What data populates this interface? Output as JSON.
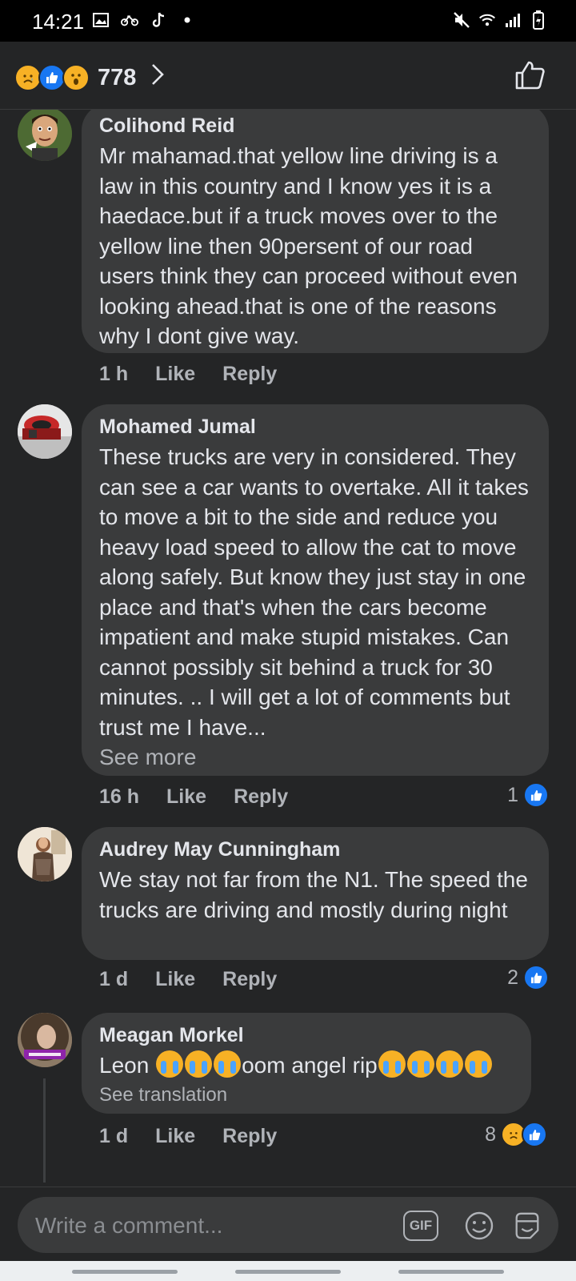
{
  "status": {
    "time": "14:21"
  },
  "header": {
    "reaction_count": "778"
  },
  "comments": [
    {
      "author": "Colihond Reid",
      "text": "Mr mahamad.that yellow line driving is a law in this country and I know yes it is a haedace.but if a truck moves over to the yellow line then 90persent of our road users think they can proceed without even looking ahead.that is one of the reasons why I dont give way.",
      "time": "1 h",
      "like": "Like",
      "reply": "Reply"
    },
    {
      "author": "Mohamed Jumal",
      "text": "These trucks are very in considered. They can see a car wants to overtake. All it takes to move a bit to the side and reduce you heavy load speed to allow the cat to move along safely. But know they just stay in one place and that's when the cars become impatient and make stupid mistakes.  Can cannot possibly sit behind a truck for 30 minutes. .. I will get a lot of comments but trust me I  have...",
      "see_more": "See more",
      "time": "16 h",
      "like": "Like",
      "reply": "Reply",
      "reaction_count": "1"
    },
    {
      "author": "Audrey May Cunningham",
      "text": "We stay not far from the N1. The speed the trucks are driving and mostly during night",
      "time": "1 d",
      "like": "Like",
      "reply": "Reply",
      "reaction_count": "2"
    },
    {
      "author": "Meagan Morkel",
      "text_before": "Leon ",
      "text_middle": "oom angel rip",
      "see_translation": "See translation",
      "time": "1 d",
      "like": "Like",
      "reply": "Reply",
      "reaction_count": "8"
    }
  ],
  "compose": {
    "placeholder": "Write a comment...",
    "gif_label": "GIF"
  },
  "colors": {
    "accent": "#1877f2",
    "bubble": "#3a3b3c",
    "background": "#242526"
  }
}
